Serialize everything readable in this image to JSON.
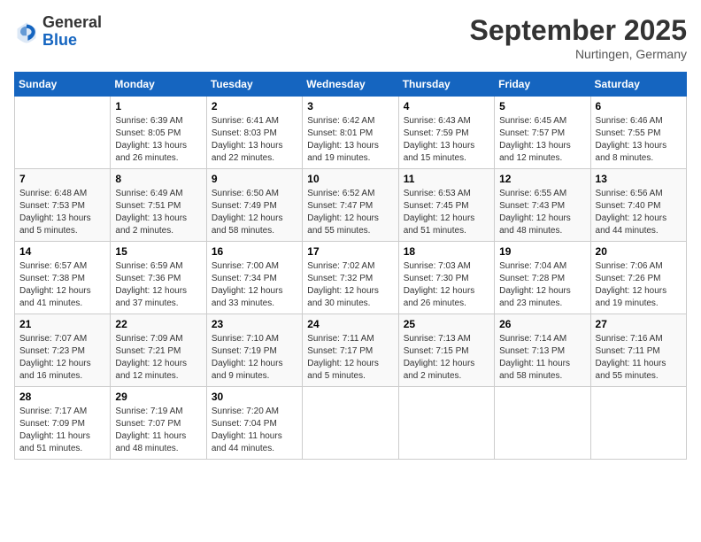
{
  "header": {
    "logo_general": "General",
    "logo_blue": "Blue",
    "month_title": "September 2025",
    "location": "Nurtingen, Germany"
  },
  "days_of_week": [
    "Sunday",
    "Monday",
    "Tuesday",
    "Wednesday",
    "Thursday",
    "Friday",
    "Saturday"
  ],
  "weeks": [
    [
      {
        "day": "",
        "info": ""
      },
      {
        "day": "1",
        "info": "Sunrise: 6:39 AM\nSunset: 8:05 PM\nDaylight: 13 hours\nand 26 minutes."
      },
      {
        "day": "2",
        "info": "Sunrise: 6:41 AM\nSunset: 8:03 PM\nDaylight: 13 hours\nand 22 minutes."
      },
      {
        "day": "3",
        "info": "Sunrise: 6:42 AM\nSunset: 8:01 PM\nDaylight: 13 hours\nand 19 minutes."
      },
      {
        "day": "4",
        "info": "Sunrise: 6:43 AM\nSunset: 7:59 PM\nDaylight: 13 hours\nand 15 minutes."
      },
      {
        "day": "5",
        "info": "Sunrise: 6:45 AM\nSunset: 7:57 PM\nDaylight: 13 hours\nand 12 minutes."
      },
      {
        "day": "6",
        "info": "Sunrise: 6:46 AM\nSunset: 7:55 PM\nDaylight: 13 hours\nand 8 minutes."
      }
    ],
    [
      {
        "day": "7",
        "info": "Sunrise: 6:48 AM\nSunset: 7:53 PM\nDaylight: 13 hours\nand 5 minutes."
      },
      {
        "day": "8",
        "info": "Sunrise: 6:49 AM\nSunset: 7:51 PM\nDaylight: 13 hours\nand 2 minutes."
      },
      {
        "day": "9",
        "info": "Sunrise: 6:50 AM\nSunset: 7:49 PM\nDaylight: 12 hours\nand 58 minutes."
      },
      {
        "day": "10",
        "info": "Sunrise: 6:52 AM\nSunset: 7:47 PM\nDaylight: 12 hours\nand 55 minutes."
      },
      {
        "day": "11",
        "info": "Sunrise: 6:53 AM\nSunset: 7:45 PM\nDaylight: 12 hours\nand 51 minutes."
      },
      {
        "day": "12",
        "info": "Sunrise: 6:55 AM\nSunset: 7:43 PM\nDaylight: 12 hours\nand 48 minutes."
      },
      {
        "day": "13",
        "info": "Sunrise: 6:56 AM\nSunset: 7:40 PM\nDaylight: 12 hours\nand 44 minutes."
      }
    ],
    [
      {
        "day": "14",
        "info": "Sunrise: 6:57 AM\nSunset: 7:38 PM\nDaylight: 12 hours\nand 41 minutes."
      },
      {
        "day": "15",
        "info": "Sunrise: 6:59 AM\nSunset: 7:36 PM\nDaylight: 12 hours\nand 37 minutes."
      },
      {
        "day": "16",
        "info": "Sunrise: 7:00 AM\nSunset: 7:34 PM\nDaylight: 12 hours\nand 33 minutes."
      },
      {
        "day": "17",
        "info": "Sunrise: 7:02 AM\nSunset: 7:32 PM\nDaylight: 12 hours\nand 30 minutes."
      },
      {
        "day": "18",
        "info": "Sunrise: 7:03 AM\nSunset: 7:30 PM\nDaylight: 12 hours\nand 26 minutes."
      },
      {
        "day": "19",
        "info": "Sunrise: 7:04 AM\nSunset: 7:28 PM\nDaylight: 12 hours\nand 23 minutes."
      },
      {
        "day": "20",
        "info": "Sunrise: 7:06 AM\nSunset: 7:26 PM\nDaylight: 12 hours\nand 19 minutes."
      }
    ],
    [
      {
        "day": "21",
        "info": "Sunrise: 7:07 AM\nSunset: 7:23 PM\nDaylight: 12 hours\nand 16 minutes."
      },
      {
        "day": "22",
        "info": "Sunrise: 7:09 AM\nSunset: 7:21 PM\nDaylight: 12 hours\nand 12 minutes."
      },
      {
        "day": "23",
        "info": "Sunrise: 7:10 AM\nSunset: 7:19 PM\nDaylight: 12 hours\nand 9 minutes."
      },
      {
        "day": "24",
        "info": "Sunrise: 7:11 AM\nSunset: 7:17 PM\nDaylight: 12 hours\nand 5 minutes."
      },
      {
        "day": "25",
        "info": "Sunrise: 7:13 AM\nSunset: 7:15 PM\nDaylight: 12 hours\nand 2 minutes."
      },
      {
        "day": "26",
        "info": "Sunrise: 7:14 AM\nSunset: 7:13 PM\nDaylight: 11 hours\nand 58 minutes."
      },
      {
        "day": "27",
        "info": "Sunrise: 7:16 AM\nSunset: 7:11 PM\nDaylight: 11 hours\nand 55 minutes."
      }
    ],
    [
      {
        "day": "28",
        "info": "Sunrise: 7:17 AM\nSunset: 7:09 PM\nDaylight: 11 hours\nand 51 minutes."
      },
      {
        "day": "29",
        "info": "Sunrise: 7:19 AM\nSunset: 7:07 PM\nDaylight: 11 hours\nand 48 minutes."
      },
      {
        "day": "30",
        "info": "Sunrise: 7:20 AM\nSunset: 7:04 PM\nDaylight: 11 hours\nand 44 minutes."
      },
      {
        "day": "",
        "info": ""
      },
      {
        "day": "",
        "info": ""
      },
      {
        "day": "",
        "info": ""
      },
      {
        "day": "",
        "info": ""
      }
    ]
  ]
}
